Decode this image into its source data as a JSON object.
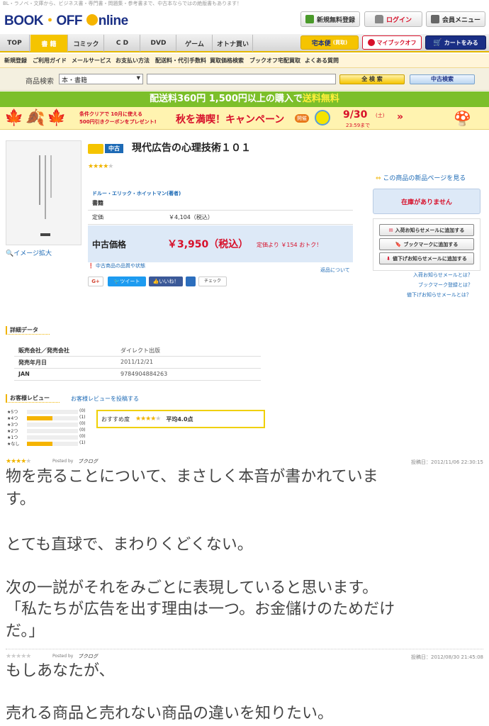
{
  "header": {
    "tagline": "BL・ラノベ・文庫から、ビジネス書・専門書・問題集・参考書まで、中古本ならではの絶版書もあります！",
    "logo_text_1": "BOOK",
    "logo_text_2": "OFF",
    "logo_text_3": "nline",
    "register_label": "新規無料登録",
    "login_label": "ログイン",
    "member_label": "会員メニュー"
  },
  "nav": {
    "tabs": [
      "TOP",
      "書 籍",
      "コミック",
      "C D",
      "DVD",
      "ゲーム",
      "オトナ買い"
    ],
    "active_index": 1,
    "takuhonbin": "宅本便",
    "takuhonbin_sub": "(買取)",
    "mybookoff": "マイブックオフ",
    "cart": "カートをみる"
  },
  "subnav": [
    "新規登録",
    "ご利用ガイド",
    "メールサービス",
    "お支払い方法",
    "配送料・代引手数料",
    "買取価格検索",
    "ブックオフ宅配買取",
    "よくある質問"
  ],
  "search": {
    "label": "商品検索",
    "category_value": "本・書籍",
    "query": "",
    "all_search": "全 検 索",
    "used_search": "中古検索"
  },
  "shipping": {
    "text": "配送料360円 1,500円以上の購入で",
    "free": "送料無料"
  },
  "campaign": {
    "line1": "条件クリアで 10月に使える",
    "line2": "500円引きクーポンをプレゼント!",
    "main": "秋を満喫！キャンペーン",
    "badge": "開催",
    "date": "9/30",
    "day": "(土)",
    "time": "23:59まで"
  },
  "product": {
    "badge": "中古",
    "title": "現代広告の心理技術１０１",
    "rating_stars": 4,
    "new_page_link": "この商品の新品ページを見る",
    "author": "ドルー・エリック・ホイットマン(著者)",
    "category": "書籍",
    "list_price_label": "定価",
    "list_price": "￥4,104（税込）",
    "used_price_label": "中古価格",
    "used_price": "￥3,950（税込）",
    "discount": "定価より ￥154 おトク！",
    "image_zoom": "イメージ拡大",
    "quality_link": "中古商品の品質や状態",
    "return_link": "返品について",
    "stock_status": "在庫がありません",
    "notify_restock": "入荷お知らせメールに追加する",
    "bookmark": "ブックマークに追加する",
    "notify_price": "値下げお知らせメールに追加する",
    "help_restock": "入荷お知らせメールとは？",
    "help_bookmark": "ブックマーク登録とは？",
    "help_price": "値下げお知らせメールとは？"
  },
  "social": {
    "gplus": "G+",
    "tweet": "ツイート",
    "like": "いいね！",
    "check": "チェック"
  },
  "details": {
    "title": "詳細データ",
    "rows": [
      {
        "label": "販売会社／発売会社",
        "value": "ダイレクト出版"
      },
      {
        "label": "発売年月日",
        "value": "2011/12/21"
      },
      {
        "label": "JAN",
        "value": "9784904884263"
      }
    ]
  },
  "reviews": {
    "title": "お客様レビュー",
    "post_link": "お客様レビューを投稿する",
    "distribution": [
      {
        "label": "★5つ",
        "count": "(0)",
        "fraction": 0
      },
      {
        "label": "★4つ",
        "count": "(1)",
        "fraction": 0.5
      },
      {
        "label": "★3つ",
        "count": "(0)",
        "fraction": 0
      },
      {
        "label": "★2つ",
        "count": "(0)",
        "fraction": 0
      },
      {
        "label": "★1つ",
        "count": "(0)",
        "fraction": 0
      },
      {
        "label": "★なし",
        "count": "(1)",
        "fraction": 0.5
      }
    ],
    "recommend_label": "おすすめ度",
    "recommend_stars": 4,
    "average": "平均4.0点",
    "items": [
      {
        "stars": 4,
        "posted_by": "Posted by",
        "source": "ブクログ",
        "date": "投稿日：2012/11/06 22:30:15",
        "lines": [
          "物を売ることについて、まさしく本音が書かれていま",
          "す。",
          "",
          "とても直球で、まわりくどくない。",
          "",
          "次の一説がそれをみごとに表現していると思います。",
          "「私たちが広告を出す理由は一つ。お金儲けのためだけ",
          "だ。」"
        ]
      },
      {
        "stars": 0,
        "posted_by": "Posted by",
        "source": "ブクログ",
        "date": "投稿日：2012/08/30 21:45:08",
        "lines": [
          "もしあなたが、",
          "",
          "売れる商品と売れない商品の違いを知りたい。"
        ]
      }
    ]
  },
  "colors": {
    "accent": "#f5c400",
    "navy": "#1a2f85",
    "green": "#7cbf2a",
    "red": "#d7102a",
    "blue": "#1d6ab5"
  }
}
